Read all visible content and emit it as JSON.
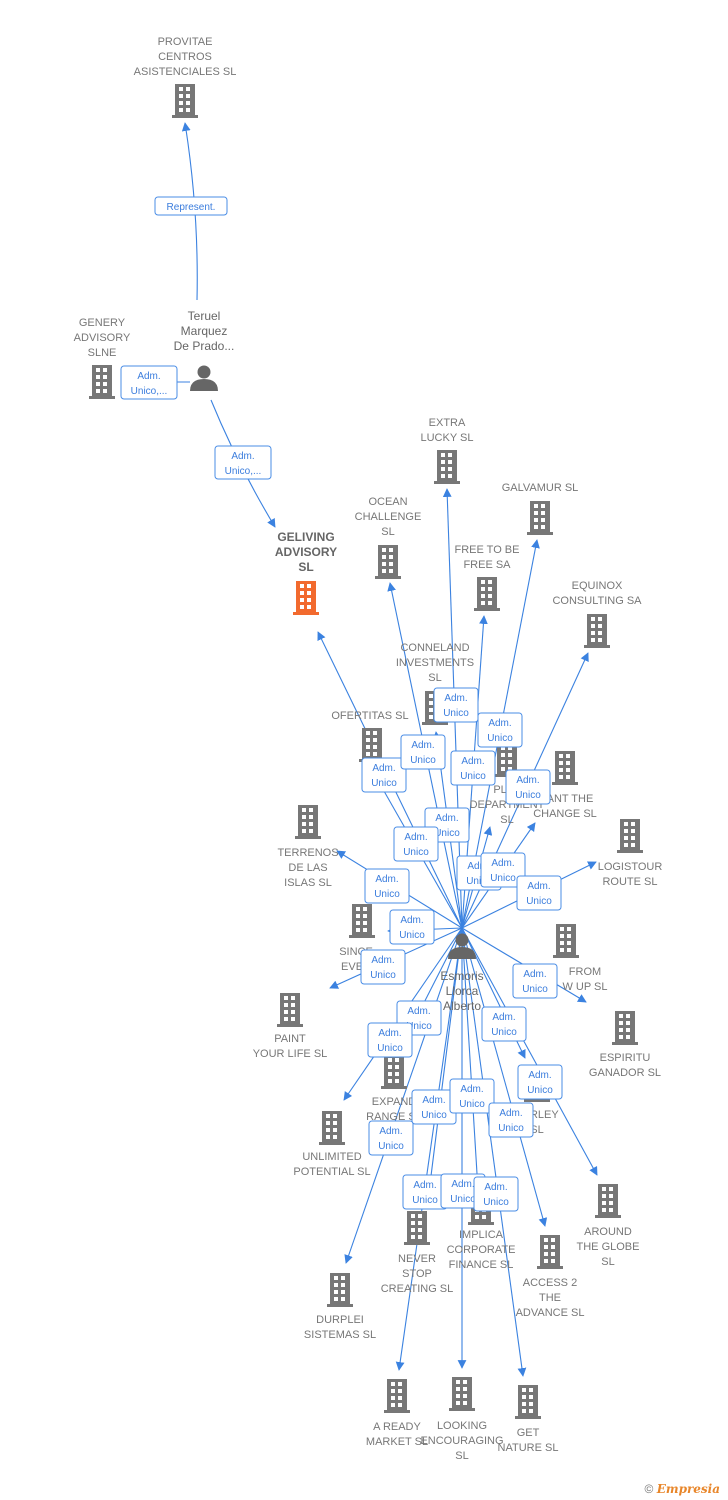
{
  "colors": {
    "edge": "#3b82e0",
    "building": "#777777",
    "highlight": "#f26a2e",
    "person": "#666666"
  },
  "nodes": [
    {
      "id": "provitae",
      "type": "company",
      "label": [
        "PROVITAE",
        "CENTROS",
        "ASISTENCIALES SL"
      ]
    },
    {
      "id": "genery",
      "type": "company",
      "label": [
        "GENERY",
        "ADVISORY",
        "SLNE"
      ]
    },
    {
      "id": "teruel",
      "type": "person",
      "label": [
        "Teruel",
        "Marquez",
        "De Prado..."
      ]
    },
    {
      "id": "geliving",
      "type": "company",
      "highlighted": true,
      "label": [
        "GELIVING",
        "ADVISORY",
        "SL"
      ]
    },
    {
      "id": "extra",
      "type": "company",
      "label": [
        "EXTRA",
        "LUCKY  SL"
      ]
    },
    {
      "id": "galvamur",
      "type": "company",
      "label": [
        "GALVAMUR  SL"
      ]
    },
    {
      "id": "ocean",
      "type": "company",
      "label": [
        "OCEAN",
        "CHALLENGE",
        "SL"
      ]
    },
    {
      "id": "free",
      "type": "company",
      "label": [
        "FREE TO BE",
        "FREE SA"
      ]
    },
    {
      "id": "equinox",
      "type": "company",
      "label": [
        "EQUINOX",
        "CONSULTING SA"
      ]
    },
    {
      "id": "conneland",
      "type": "company",
      "label": [
        "CONNELAND",
        "INVESTMENTS",
        "SL"
      ]
    },
    {
      "id": "ofertitas",
      "type": "company",
      "label": [
        "OFERTITAS  SL"
      ]
    },
    {
      "id": "play",
      "type": "company",
      "label": [
        "PLAY",
        "DEPARTMENT",
        "SL"
      ]
    },
    {
      "id": "want",
      "type": "company",
      "label": [
        "WANT THE",
        "CHANGE  SL"
      ]
    },
    {
      "id": "terrenos",
      "type": "company",
      "label": [
        "TERRENOS",
        "DE LAS",
        "ISLAS  SL"
      ]
    },
    {
      "id": "logistour",
      "type": "company",
      "label": [
        "LOGISTOUR",
        "ROUTE  SL"
      ]
    },
    {
      "id": "since",
      "type": "company",
      "label": [
        "SINCE",
        "EVER"
      ]
    },
    {
      "id": "from",
      "type": "company",
      "label": [
        "FROM",
        "W UP  SL"
      ]
    },
    {
      "id": "esmoris",
      "type": "person",
      "label": [
        "Esmoris",
        "Llorca",
        "Alberto"
      ]
    },
    {
      "id": "paint",
      "type": "company",
      "label": [
        "PAINT",
        "YOUR LIFE  SL"
      ]
    },
    {
      "id": "espiritu",
      "type": "company",
      "label": [
        "ESPIRITU",
        "GANADOR SL"
      ]
    },
    {
      "id": "expand",
      "type": "company",
      "label": [
        "EXPAND",
        "RANGE  SL"
      ]
    },
    {
      "id": "barley",
      "type": "company",
      "label": [
        "BARLEY",
        "SL"
      ]
    },
    {
      "id": "unlimited",
      "type": "company",
      "label": [
        "UNLIMITED",
        "POTENTIAL  SL"
      ]
    },
    {
      "id": "around",
      "type": "company",
      "label": [
        "AROUND",
        "THE GLOBE",
        "SL"
      ]
    },
    {
      "id": "never",
      "type": "company",
      "label": [
        "NEVER",
        "STOP",
        "CREATING  SL"
      ]
    },
    {
      "id": "implica",
      "type": "company",
      "label": [
        "IMPLICA",
        "CORPORATE",
        "FINANCE  SL"
      ]
    },
    {
      "id": "access",
      "type": "company",
      "label": [
        "ACCESS 2",
        "THE",
        "ADVANCE  SL"
      ]
    },
    {
      "id": "durplei",
      "type": "company",
      "label": [
        "DURPLEI",
        "SISTEMAS  SL"
      ]
    },
    {
      "id": "aready",
      "type": "company",
      "label": [
        "A READY",
        "MARKET  SL"
      ]
    },
    {
      "id": "looking",
      "type": "company",
      "label": [
        "LOOKING",
        "ENCOURAGING",
        "SL"
      ]
    },
    {
      "id": "getnature",
      "type": "company",
      "label": [
        "GET",
        "NATURE  SL"
      ]
    }
  ],
  "edges": [
    {
      "from": "teruel",
      "to": "provitae",
      "label": [
        "Represent."
      ]
    },
    {
      "from": "teruel",
      "to": "genery",
      "label": [
        "Adm.",
        "Unico,..."
      ]
    },
    {
      "from": "teruel",
      "to": "geliving",
      "label": [
        "Adm.",
        "Unico,..."
      ]
    },
    {
      "from": "esmoris",
      "to": "geliving",
      "label": [
        "Adm.",
        "Unico"
      ]
    },
    {
      "from": "esmoris",
      "to": "ocean",
      "label": [
        "Adm.",
        "Unico"
      ]
    },
    {
      "from": "esmoris",
      "to": "extra",
      "label": [
        "Adm.",
        "Unico"
      ]
    },
    {
      "from": "esmoris",
      "to": "free",
      "label": [
        "Adm.",
        "Unico"
      ]
    },
    {
      "from": "esmoris",
      "to": "galvamur",
      "label": [
        "Adm.",
        "Unico"
      ]
    },
    {
      "from": "esmoris",
      "to": "equinox",
      "label": [
        "Adm.",
        "Unico"
      ]
    },
    {
      "from": "esmoris",
      "to": "conneland",
      "label": [
        "Adm.",
        "Unico"
      ]
    },
    {
      "from": "esmoris",
      "to": "ofertitas",
      "label": [
        "Adm.",
        "Unico"
      ]
    },
    {
      "from": "esmoris",
      "to": "play",
      "label": [
        "Adm.",
        "Unico"
      ]
    },
    {
      "from": "esmoris",
      "to": "want",
      "label": [
        "Adm.",
        "Unico"
      ]
    },
    {
      "from": "esmoris",
      "to": "logistour",
      "label": [
        "Adm.",
        "Unico"
      ]
    },
    {
      "from": "esmoris",
      "to": "terrenos",
      "label": [
        "Adm.",
        "Unico"
      ]
    },
    {
      "from": "esmoris",
      "to": "since",
      "label": [
        "Adm.",
        "Unico"
      ]
    },
    {
      "from": "esmoris",
      "to": "from",
      "label": [
        "Adm.",
        "Unico"
      ]
    },
    {
      "from": "esmoris",
      "to": "paint",
      "label": [
        "Adm.",
        "Unico"
      ]
    },
    {
      "from": "esmoris",
      "to": "barley",
      "label": [
        "Adm.",
        "Unico"
      ]
    },
    {
      "from": "esmoris",
      "to": "expand",
      "label": [
        "Adm.",
        "Unico"
      ]
    },
    {
      "from": "esmoris",
      "to": "unlimited",
      "label": [
        "Adm.",
        "Unico"
      ]
    },
    {
      "from": "esmoris",
      "to": "around",
      "label": [
        "Adm.",
        "Unico"
      ]
    },
    {
      "from": "esmoris",
      "to": "never",
      "label": [
        "Adm.",
        "Unico"
      ]
    },
    {
      "from": "esmoris",
      "to": "implica",
      "label": [
        "Adm.",
        "Unico"
      ]
    },
    {
      "from": "esmoris",
      "to": "access",
      "label": [
        "Adm.",
        "Unico"
      ]
    },
    {
      "from": "esmoris",
      "to": "durplei",
      "label": [
        "Adm.",
        "Unico"
      ]
    },
    {
      "from": "esmoris",
      "to": "aready",
      "label": [
        "Adm.",
        "Unico"
      ]
    },
    {
      "from": "esmoris",
      "to": "looking",
      "label": [
        "Adm.",
        "Unico"
      ]
    },
    {
      "from": "esmoris",
      "to": "getnature",
      "label": [
        "Adm.",
        "Unico"
      ]
    }
  ],
  "footer": {
    "copyright_symbol": "©",
    "brand": "Empresia"
  }
}
